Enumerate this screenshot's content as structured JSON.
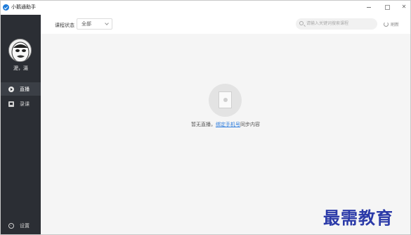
{
  "window": {
    "title": "小鹅通助手"
  },
  "sidebar": {
    "user_name": "淝，滠",
    "items": [
      {
        "label": "直播",
        "icon": "play-circle-icon",
        "active": true
      },
      {
        "label": "录课",
        "icon": "recorded-lesson-icon",
        "active": false
      }
    ],
    "settings_label": "设置"
  },
  "toolbar": {
    "status_label": "课程状态",
    "status_value": "全部",
    "search_placeholder": "请输入关键词搜索课程",
    "refresh_label": "刷新"
  },
  "empty_state": {
    "prefix": "暂无直播，",
    "link_text": "绑定手机号",
    "suffix": "同步内容"
  },
  "watermark": {
    "text": "最需教育"
  }
}
